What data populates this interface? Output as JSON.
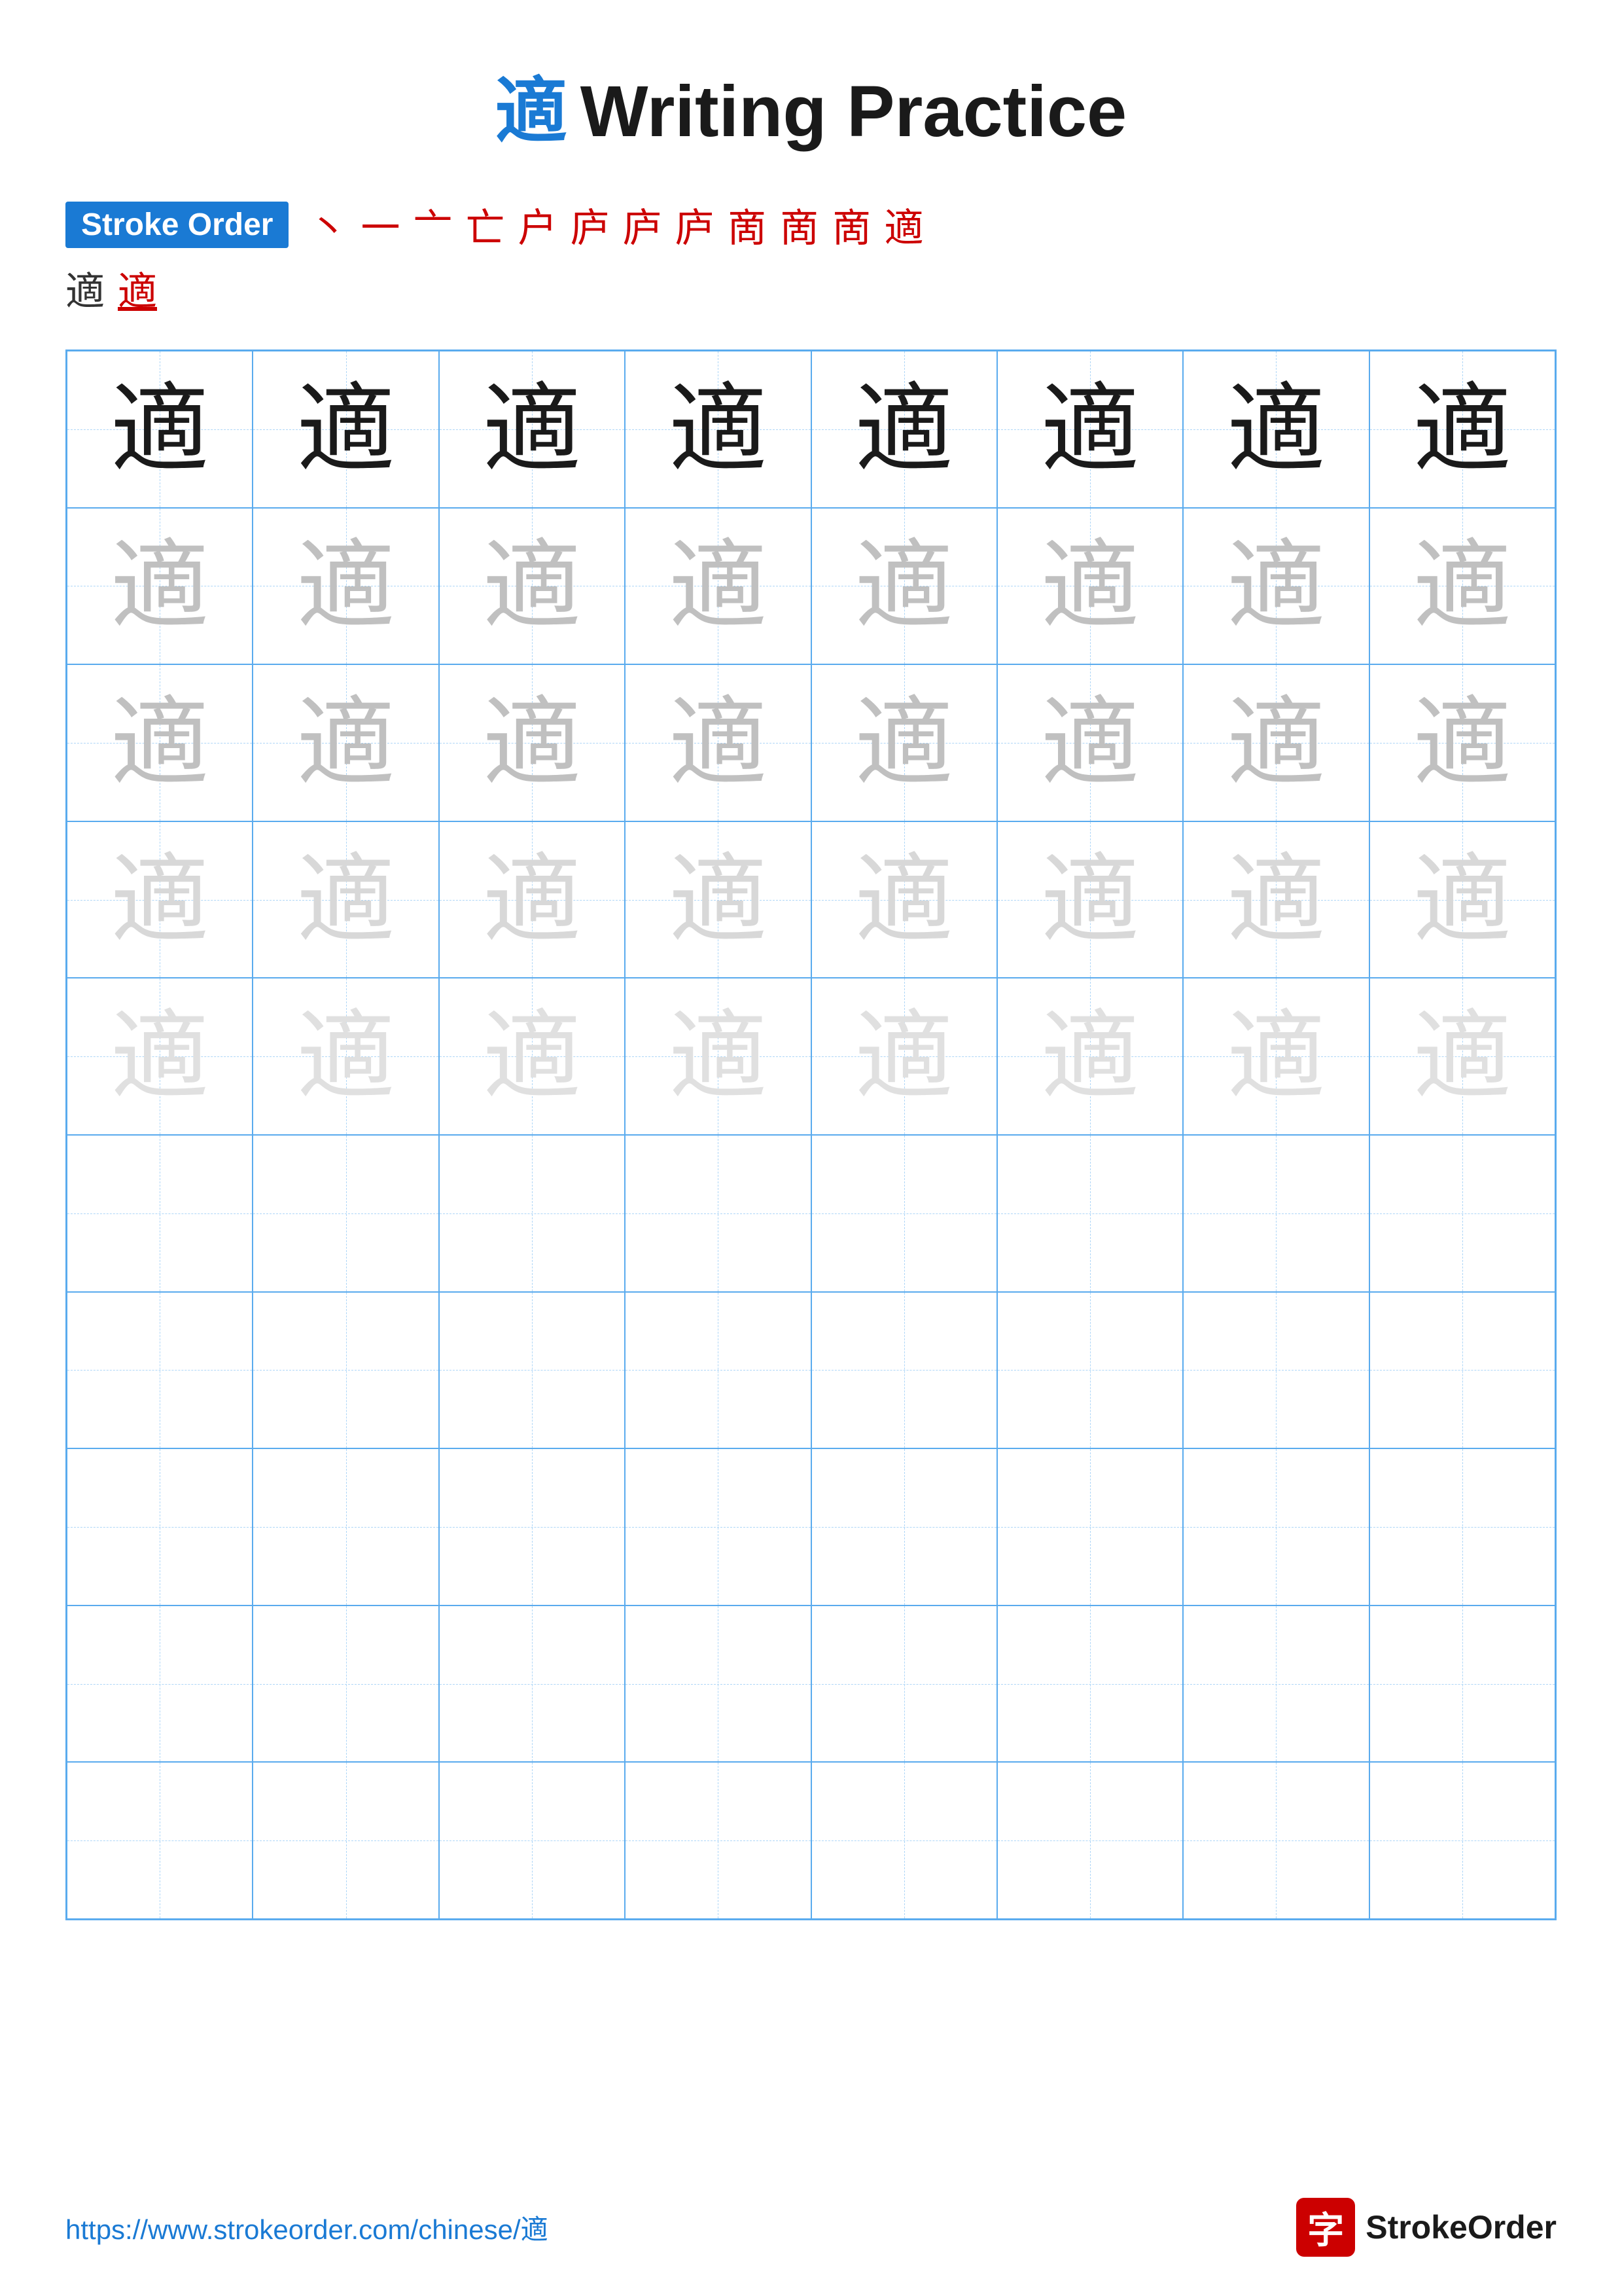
{
  "title": {
    "char": "適",
    "text": "Writing Practice"
  },
  "stroke_order": {
    "badge_label": "Stroke Order",
    "strokes": [
      "丶",
      "一",
      "亠",
      "亡",
      "户",
      "庐",
      "庐",
      "庐",
      "商",
      "啇",
      "啇",
      "適"
    ],
    "preview_chars": [
      "適",
      "適"
    ]
  },
  "grid": {
    "cols": 8,
    "rows": 10,
    "char": "適",
    "row_styles": [
      "dark",
      "medium-gray",
      "medium-gray",
      "light-gray",
      "lighter-gray",
      "empty",
      "empty",
      "empty",
      "empty",
      "empty"
    ]
  },
  "footer": {
    "url": "https://www.strokeorder.com/chinese/適",
    "logo_text": "StrokeOrder",
    "logo_char": "字"
  }
}
